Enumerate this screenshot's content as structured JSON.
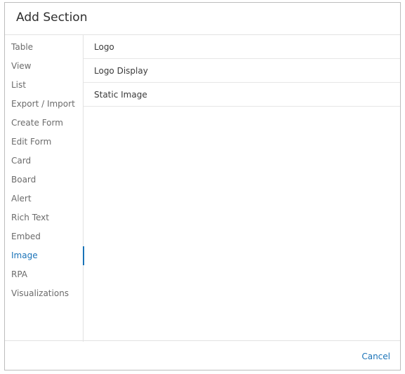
{
  "dialog": {
    "title": "Add Section",
    "cancel_label": "Cancel"
  },
  "categories": [
    {
      "label": "Table"
    },
    {
      "label": "View"
    },
    {
      "label": "List"
    },
    {
      "label": "Export / Import"
    },
    {
      "label": "Create Form"
    },
    {
      "label": "Edit Form"
    },
    {
      "label": "Card"
    },
    {
      "label": "Board"
    },
    {
      "label": "Alert"
    },
    {
      "label": "Rich Text"
    },
    {
      "label": "Embed"
    },
    {
      "label": "Image"
    },
    {
      "label": "RPA"
    },
    {
      "label": "Visualizations"
    }
  ],
  "selected_category": "Image",
  "sections": [
    {
      "label": "Logo"
    },
    {
      "label": "Logo Display"
    },
    {
      "label": "Static Image"
    }
  ],
  "colors": {
    "accent": "#1a73b8",
    "border": "#e2e2e2",
    "text": "#4a4a4a"
  }
}
